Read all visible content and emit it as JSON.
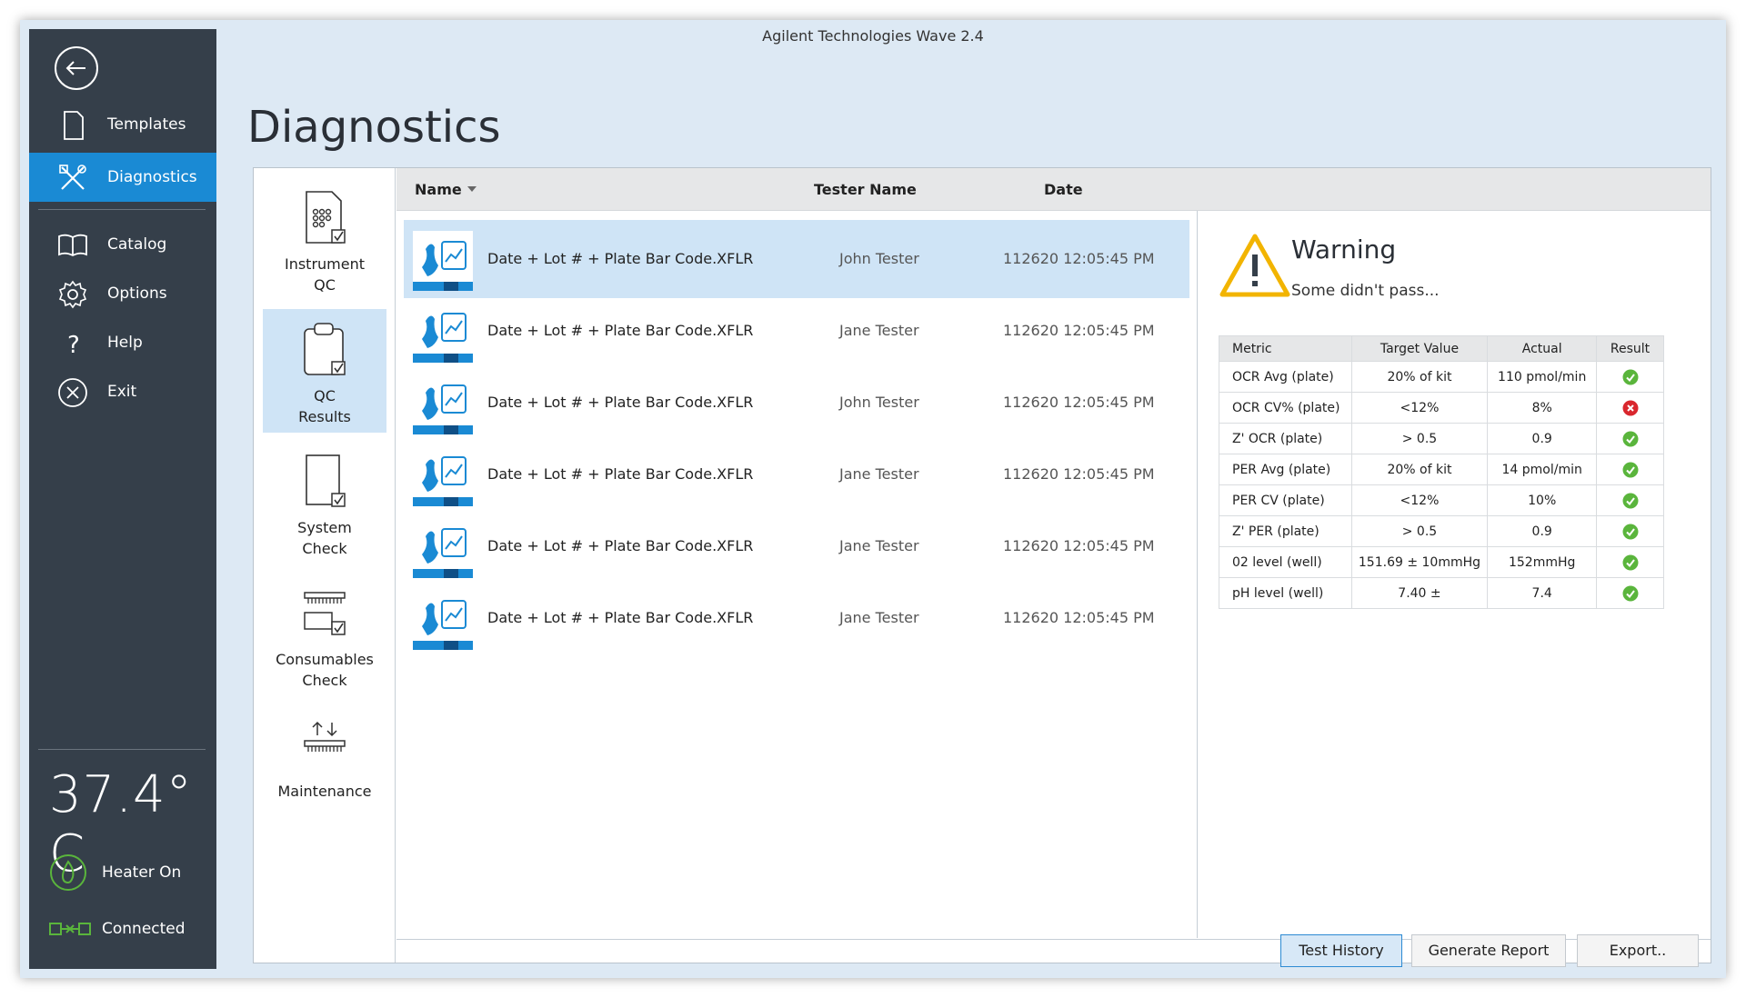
{
  "window": {
    "title": "Agilent Technologies Wave 2.4"
  },
  "sidebar": {
    "items": [
      {
        "label": "Templates",
        "icon": "document-icon"
      },
      {
        "label": "Diagnostics",
        "icon": "tools-icon"
      },
      {
        "label": "Catalog",
        "icon": "book-icon"
      },
      {
        "label": "Options",
        "icon": "gear-icon"
      },
      {
        "label": "Help",
        "icon": "help-icon"
      },
      {
        "label": "Exit",
        "icon": "close-circle-icon"
      }
    ],
    "active": "Diagnostics",
    "temperature": "37.4° C",
    "heater": "Heater On",
    "connection": "Connected"
  },
  "page": {
    "title": "Diagnostics"
  },
  "tools": [
    {
      "label": "Instrument\nQC"
    },
    {
      "label": "QC\nResults"
    },
    {
      "label": "System\nCheck"
    },
    {
      "label": "Consumables\nCheck"
    },
    {
      "label": "Maintenance"
    }
  ],
  "list": {
    "headers": {
      "name": "Name",
      "tester": "Tester Name",
      "date": "Date"
    },
    "rows": [
      {
        "name": "Date + Lot # + Plate Bar Code.XFLR",
        "tester": "John Tester",
        "date": "112620 12:05:45 PM"
      },
      {
        "name": "Date + Lot # + Plate Bar Code.XFLR",
        "tester": "Jane Tester",
        "date": "112620 12:05:45 PM"
      },
      {
        "name": "Date + Lot # + Plate Bar Code.XFLR",
        "tester": "John Tester",
        "date": "112620 12:05:45 PM"
      },
      {
        "name": "Date + Lot # + Plate Bar Code.XFLR",
        "tester": "Jane Tester",
        "date": "112620 12:05:45 PM"
      },
      {
        "name": "Date + Lot # + Plate Bar Code.XFLR",
        "tester": "Jane Tester",
        "date": "112620 12:05:45 PM"
      },
      {
        "name": "Date + Lot # + Plate Bar Code.XFLR",
        "tester": "Jane Tester",
        "date": "112620 12:05:45 PM"
      }
    ]
  },
  "detail": {
    "title": "Warning",
    "subtitle": "Some didn't pass...",
    "table": {
      "headers": {
        "metric": "Metric",
        "target": "Target Value",
        "actual": "Actual",
        "result": "Result"
      },
      "rows": [
        {
          "metric": "OCR Avg (plate)",
          "target": "20% of kit",
          "actual": "110 pmol/min",
          "result": "pass"
        },
        {
          "metric": "OCR CV% (plate)",
          "target": "<12%",
          "actual": "8%",
          "result": "fail"
        },
        {
          "metric": "Z' OCR (plate)",
          "target": "> 0.5",
          "actual": "0.9",
          "result": "pass"
        },
        {
          "metric": "PER Avg (plate)",
          "target": "20% of kit",
          "actual": "14 pmol/min",
          "result": "pass"
        },
        {
          "metric": "PER CV (plate)",
          "target": "<12%",
          "actual": "10%",
          "result": "pass"
        },
        {
          "metric": "Z' PER (plate)",
          "target": "> 0.5",
          "actual": "0.9",
          "result": "pass"
        },
        {
          "metric": "02 level (well)",
          "target": "151.69 ± 10mmHg",
          "actual": "152mmHg",
          "result": "pass"
        },
        {
          "metric": "pH level (well)",
          "target": "7.40 ±",
          "actual": "7.4",
          "result": "pass"
        }
      ]
    }
  },
  "buttons": {
    "history": "Test History",
    "report": "Generate Report",
    "export": "Export.."
  },
  "colors": {
    "sidebar": "#353f4a",
    "accent": "#1a8ad4",
    "selected": "#cfe4f6",
    "pass": "#5ab53c",
    "fail": "#d9272e",
    "warning": "#f2b400"
  }
}
